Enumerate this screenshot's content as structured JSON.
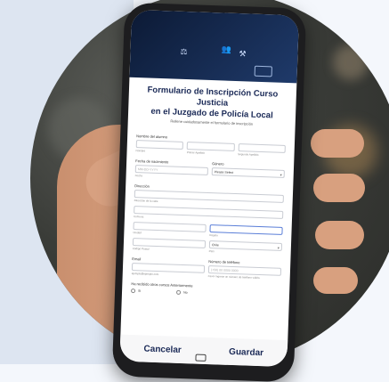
{
  "form": {
    "title_line1": "Formulario de Inscripción Curso Justicia",
    "title_line2": "en el Juzgado de Policía Local",
    "subtitle": "Rellene cuidadosamente el formulario de inscripción",
    "name_label": "Nombre del alumno",
    "name_sub": [
      "Nombre",
      "Primer Apellido",
      "Segundo Apellido"
    ],
    "dob_label": "Fecha de nacimiento",
    "dob_placeholder": "MM-DD-YYYY",
    "dob_sub": "Fecha",
    "gender_label": "Género",
    "gender_value": "Please Select",
    "address_label": "Dirección",
    "address_sub": "Dirección de la calle",
    "comuna_sub": "Comuna",
    "city_sub": "Ciudad",
    "region_sub": "Región",
    "postal_sub": "Código Postal",
    "country_value": "Chile",
    "country_sub": "País",
    "email_label": "Email",
    "email_sub": "ejemplo@ejemplo.com",
    "phone_label": "Número de teléfono",
    "phone_placeholder": "(+56) 00 0000 0000",
    "phone_sub": "Favor ingrese un número de teléfono válido.",
    "prev_courses_label": "Ha recibido otros cursos Anteriormente",
    "opt_yes": "Si",
    "opt_no": "No",
    "cancel_label": "Cancelar",
    "save_label": "Guardar"
  },
  "colors": {
    "accent": "#1b2a57",
    "focus": "#5b7fd8"
  }
}
